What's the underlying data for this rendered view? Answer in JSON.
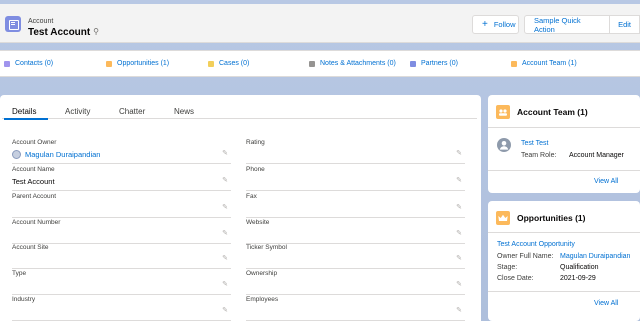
{
  "header": {
    "object_type": "Account",
    "record_name": "Test Account",
    "buttons": {
      "follow": "Follow",
      "quick_action": "Sample Quick Action",
      "edit": "Edit"
    }
  },
  "related_links": [
    {
      "label": "Contacts (0)",
      "color": "#a094ed"
    },
    {
      "label": "Opportunities (1)",
      "color": "#fcb95b"
    },
    {
      "label": "Cases (0)",
      "color": "#f2cf5b"
    },
    {
      "label": "Notes & Attachments (0)",
      "color": "#969492"
    },
    {
      "label": "Partners (0)",
      "color": "#7f8de1"
    },
    {
      "label": "Account Team (1)",
      "color": "#fcb95b"
    }
  ],
  "tabs": [
    "Details",
    "Activity",
    "Chatter",
    "News"
  ],
  "details": {
    "left": [
      {
        "label": "Account Owner",
        "value": "Magulan Duraipandian"
      },
      {
        "label": "Account Name",
        "value": "Test Account"
      },
      {
        "label": "Parent Account",
        "value": ""
      },
      {
        "label": "Account Number",
        "value": ""
      },
      {
        "label": "Account Site",
        "value": ""
      },
      {
        "label": "Type",
        "value": ""
      },
      {
        "label": "Industry",
        "value": ""
      }
    ],
    "right": [
      {
        "label": "Rating",
        "value": ""
      },
      {
        "label": "Phone",
        "value": ""
      },
      {
        "label": "Fax",
        "value": ""
      },
      {
        "label": "Website",
        "value": ""
      },
      {
        "label": "Ticker Symbol",
        "value": ""
      },
      {
        "label": "Ownership",
        "value": ""
      },
      {
        "label": "Employees",
        "value": ""
      }
    ]
  },
  "account_team": {
    "title": "Account Team (1)",
    "member_name": "Test Test",
    "role_label": "Team Role:",
    "role_value": "Account Manager",
    "view_all": "View All"
  },
  "opportunities": {
    "title": "Opportunities (1)",
    "name": "Test Account Opportunity",
    "owner_label": "Owner Full Name:",
    "owner_value": "Magulan Duraipandian",
    "stage_label": "Stage:",
    "stage_value": "Qualification",
    "close_label": "Close Date:",
    "close_value": "2021-09-29",
    "view_all": "View All"
  },
  "colors": {
    "link": "#0070d2",
    "account_icon": "#7f8de1",
    "team_icon": "#fcb95b",
    "opportunity_icon": "#fcb95b"
  }
}
